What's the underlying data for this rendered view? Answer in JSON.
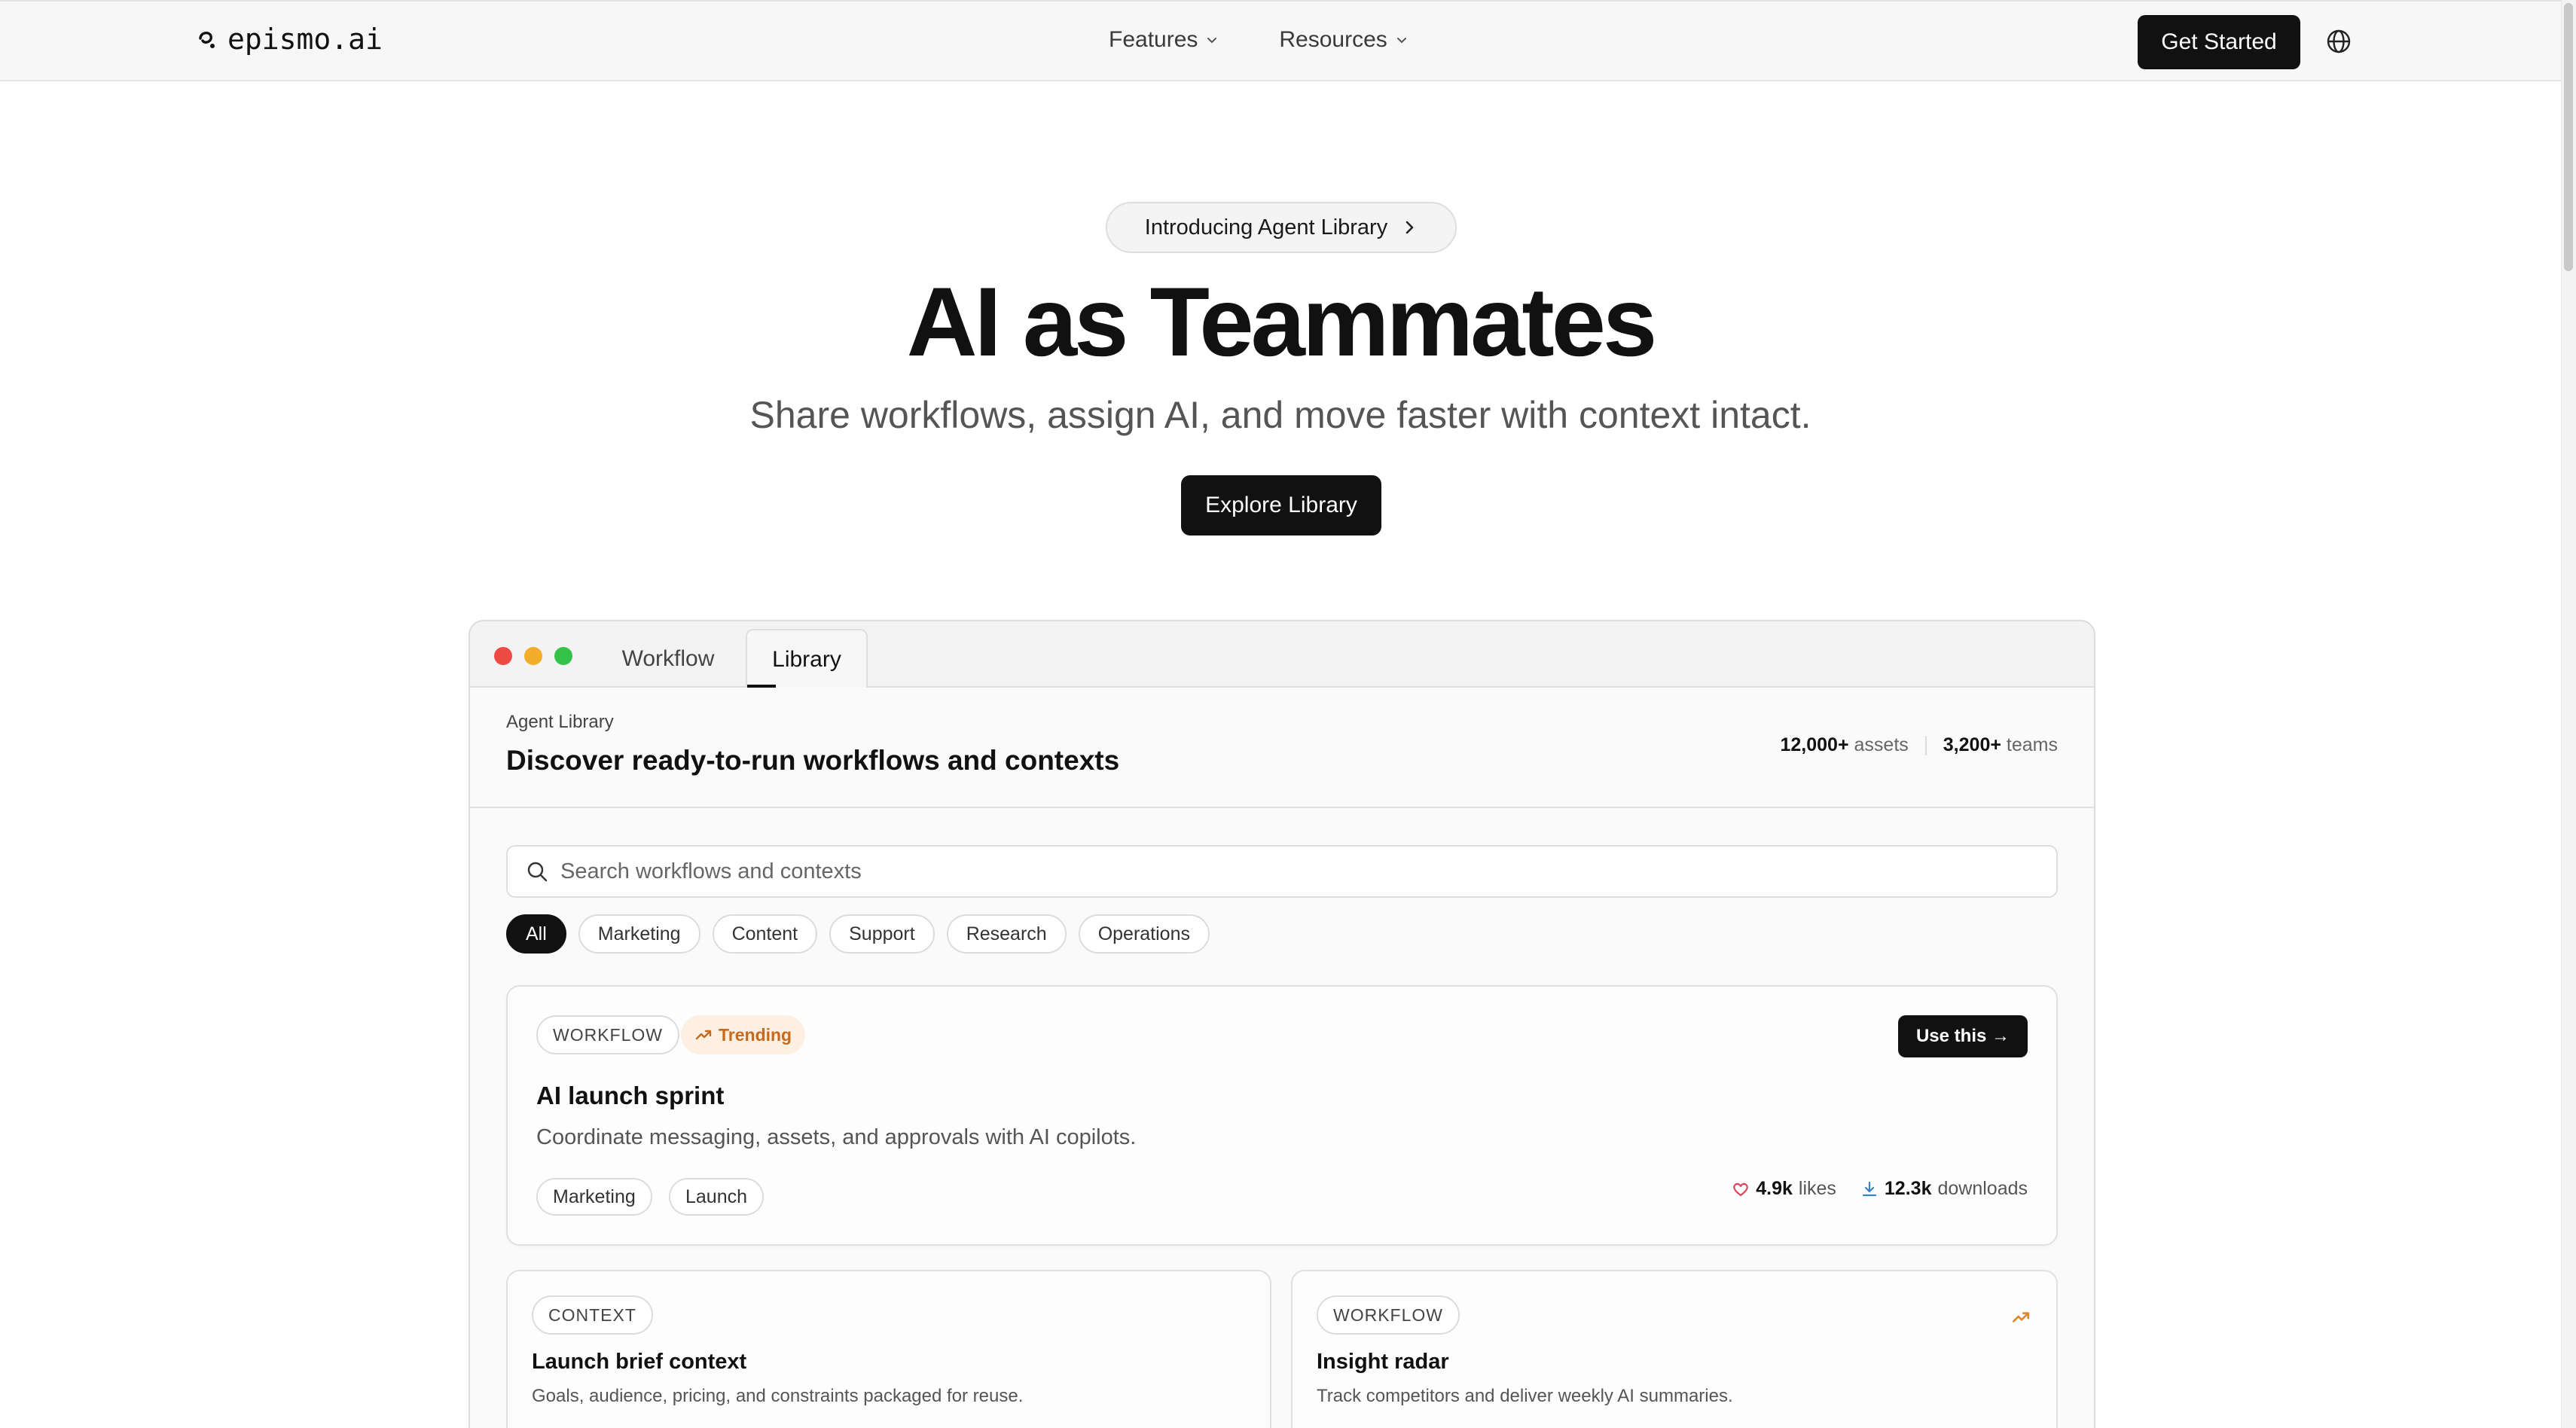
{
  "nav": {
    "logo_text": "epismo.ai",
    "items": [
      {
        "label": "Features"
      },
      {
        "label": "Resources"
      }
    ],
    "cta_label": "Get Started",
    "globe_icon": "globe-icon"
  },
  "hero": {
    "pill_label": "Introducing Agent Library",
    "title": "AI as Teammates",
    "subtitle": "Share workflows, assign AI, and move faster with context intact.",
    "cta_label": "Explore Library"
  },
  "window": {
    "tabs": [
      {
        "label": "Workflow",
        "active": false
      },
      {
        "label": "Library",
        "active": true
      }
    ],
    "library": {
      "eyebrow": "Agent Library",
      "title": "Discover ready-to-run workflows and contexts",
      "stats": {
        "assets_value": "12,000+",
        "assets_label": "assets",
        "teams_value": "3,200+",
        "teams_label": "teams"
      },
      "search_placeholder": "Search workflows and contexts",
      "filters": [
        "All",
        "Marketing",
        "Content",
        "Support",
        "Research",
        "Operations"
      ],
      "active_filter": "All",
      "featured": {
        "type": "WORKFLOW",
        "trend_label": "Trending",
        "use_label": "Use this →",
        "title": "AI launch sprint",
        "description": "Coordinate messaging, assets, and approvals with AI copilots.",
        "tags": [
          "Marketing",
          "Launch"
        ],
        "likes_value": "4.9k",
        "likes_label": "likes",
        "downloads_value": "12.3k",
        "downloads_label": "downloads"
      },
      "cards": [
        {
          "type": "CONTEXT",
          "title": "Launch brief context",
          "description": "Goals, audience, pricing, and constraints packaged for reuse.",
          "trending": false
        },
        {
          "type": "WORKFLOW",
          "title": "Insight radar",
          "description": "Track competitors and deliver weekly AI summaries.",
          "trending": true
        }
      ]
    }
  },
  "colors": {
    "accent_dark": "#111111",
    "trend_orange": "#c76a1c",
    "trend_bg": "#fdf0e3",
    "traffic_red": "#ee4a44",
    "traffic_yellow": "#f2ad2b",
    "traffic_green": "#35c24a"
  }
}
